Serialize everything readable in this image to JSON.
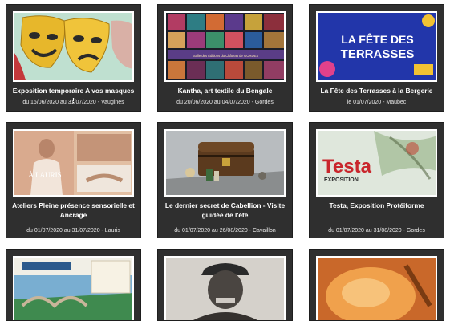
{
  "events": [
    {
      "title": "Exposition temporaire A vos masques !",
      "dates": "du 16/06/2020 au 31/07/2020 - Vaugines",
      "image_text": ""
    },
    {
      "title": "Kantha, art textile du Bengale",
      "dates": "du 20/06/2020 au 04/07/2020 - Gordes",
      "image_text": "Salle des Éditions du Château de GORDES"
    },
    {
      "title": "La Fête des Terrasses à la Bergerie",
      "dates": "le 01/07/2020 - Maubec",
      "image_text": {
        "line1": "LA FÊTE DES",
        "line2": "TERRASSES"
      }
    },
    {
      "title": "Ateliers Pleine présence sensorielle et Ancrage",
      "dates": "du 01/07/2020 au 31/07/2020 - Lauris",
      "image_text": "À LAURIS"
    },
    {
      "title": "Le dernier secret de Cabellion - Visite guidée de l'été",
      "dates": "du 01/07/2020 au 26/08/2020 - Cavaillon",
      "image_text": ""
    },
    {
      "title": "Testa, Exposition Protéiforme",
      "dates": "du 01/07/2020 au 31/08/2020 - Gordes",
      "image_text": {
        "word": "Testa",
        "sub": "EXPOSITION"
      }
    },
    {
      "title": "",
      "dates": "",
      "image_text": ""
    },
    {
      "title": "",
      "dates": "",
      "image_text": ""
    },
    {
      "title": "",
      "dates": "",
      "image_text": ""
    }
  ],
  "colors": {
    "card_bg": "#2f2f2f",
    "page_bg": "#ffffff",
    "testa_red": "#c9262c",
    "fete_blue": "#2438b8"
  }
}
